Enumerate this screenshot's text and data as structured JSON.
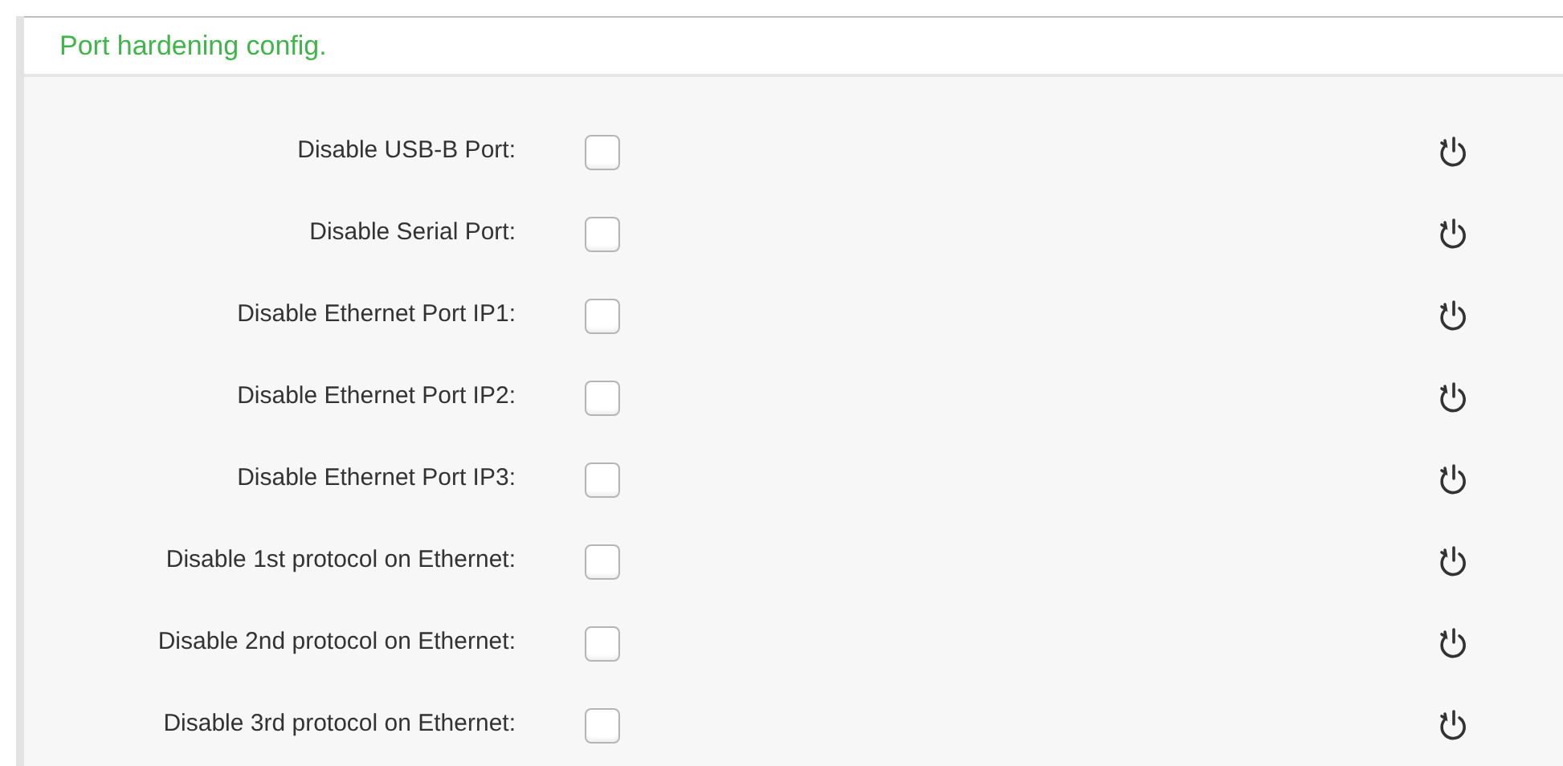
{
  "panel": {
    "title": "Port hardening config."
  },
  "rows": [
    {
      "label": "Disable USB-B Port:",
      "checked": false
    },
    {
      "label": "Disable Serial Port:",
      "checked": false
    },
    {
      "label": "Disable Ethernet Port IP1:",
      "checked": false
    },
    {
      "label": "Disable Ethernet Port IP2:",
      "checked": false
    },
    {
      "label": "Disable Ethernet Port IP3:",
      "checked": false
    },
    {
      "label": "Disable 1st protocol on Ethernet:",
      "checked": false
    },
    {
      "label": "Disable 2nd protocol on Ethernet:",
      "checked": false
    },
    {
      "label": "Disable 3rd protocol on Ethernet:",
      "checked": false
    }
  ]
}
